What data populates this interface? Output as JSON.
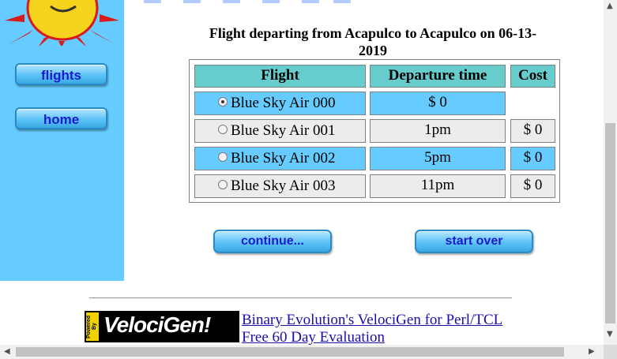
{
  "sidebar": {
    "flights_label": "flights",
    "home_label": "home"
  },
  "heading": {
    "line1": "Flight departing from Acapulco to Acapulco on 06-13-",
    "line2": "2019"
  },
  "table": {
    "headers": [
      "Flight",
      "Departure time",
      "Cost"
    ],
    "rows": [
      {
        "flight": "Blue Sky Air 000",
        "time": "$ 0",
        "cost": "",
        "selected": true,
        "style": "blue"
      },
      {
        "flight": "Blue Sky Air 001",
        "time": "1pm",
        "cost": "$ 0",
        "selected": false,
        "style": "gray"
      },
      {
        "flight": "Blue Sky Air 002",
        "time": "5pm",
        "cost": "$ 0",
        "selected": false,
        "style": "blue"
      },
      {
        "flight": "Blue Sky Air 003",
        "time": "11pm",
        "cost": "$ 0",
        "selected": false,
        "style": "gray"
      }
    ]
  },
  "actions": {
    "continue_label": "continue...",
    "start_over_label": "start over"
  },
  "footer": {
    "logo_powered": "Powered By",
    "logo_text": "VelociGen!",
    "ad_line1": "Binary Evolution's VelociGen for Perl/TCL",
    "ad_line2": "Free 60 Day Evaluation"
  },
  "colors": {
    "sidebar": "#66ccff",
    "header_cell": "#66cccc",
    "blue_row": "#66ccff",
    "gray_row": "#ececec",
    "button_text": "#1a1ad0"
  },
  "icons": [
    "sun-logo-icon",
    "radio-icon",
    "scroll-left-arrow-icon",
    "scroll-right-arrow-icon",
    "scroll-up-arrow-icon",
    "scroll-down-arrow-icon"
  ]
}
